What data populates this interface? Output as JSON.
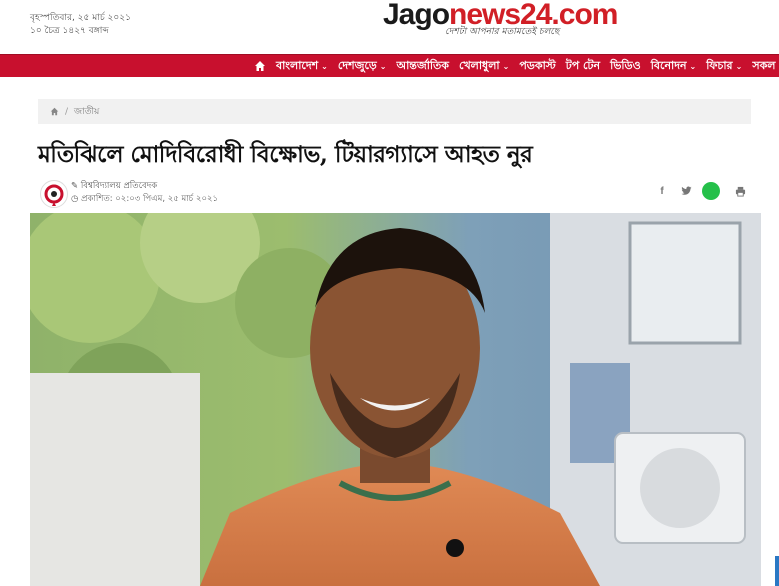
{
  "header": {
    "date_line1": "বৃহস্পতিবার, ২৫ মার্চ ২০২১",
    "date_line2": "১০ চৈত্র ১৪২৭ বঙ্গাব্দ",
    "logo_part1": "Jago",
    "logo_part2": "news24.com",
    "logo_tagline": "দেশটা আপনার মতামতেই চলছে"
  },
  "nav": {
    "home_icon": "home-icon",
    "items": [
      {
        "label": "বাংলাদেশ",
        "dropdown": true
      },
      {
        "label": "দেশজুড়ে",
        "dropdown": true
      },
      {
        "label": "আন্তর্জাতিক",
        "dropdown": false
      },
      {
        "label": "খেলাধুলা",
        "dropdown": true
      },
      {
        "label": "পডকাস্ট",
        "dropdown": false
      },
      {
        "label": "টপ টেন",
        "dropdown": false
      },
      {
        "label": "ভিডিও",
        "dropdown": false
      },
      {
        "label": "বিনোদন",
        "dropdown": true
      },
      {
        "label": "ফিচার",
        "dropdown": true
      },
      {
        "label": "সকল",
        "dropdown": false
      }
    ],
    "bar_color": "#c8102e"
  },
  "breadcrumb": {
    "category": "জাতীয়"
  },
  "article": {
    "headline": "মতিঝিলে মোদিবিরোধী বিক্ষোভ, টিয়ারগ্যাসে আহত নুর",
    "author": "বিশ্ববিদ্যালয় প্রতিবেদক",
    "published": "প্রকাশিত: ০২:০৩ পিএম, ২৫ মার্চ ২০২১"
  },
  "share": {
    "facebook": "f",
    "twitter_icon": "twitter-icon",
    "print_icon": "print-icon",
    "whatsapp_color": "#25c04a"
  }
}
